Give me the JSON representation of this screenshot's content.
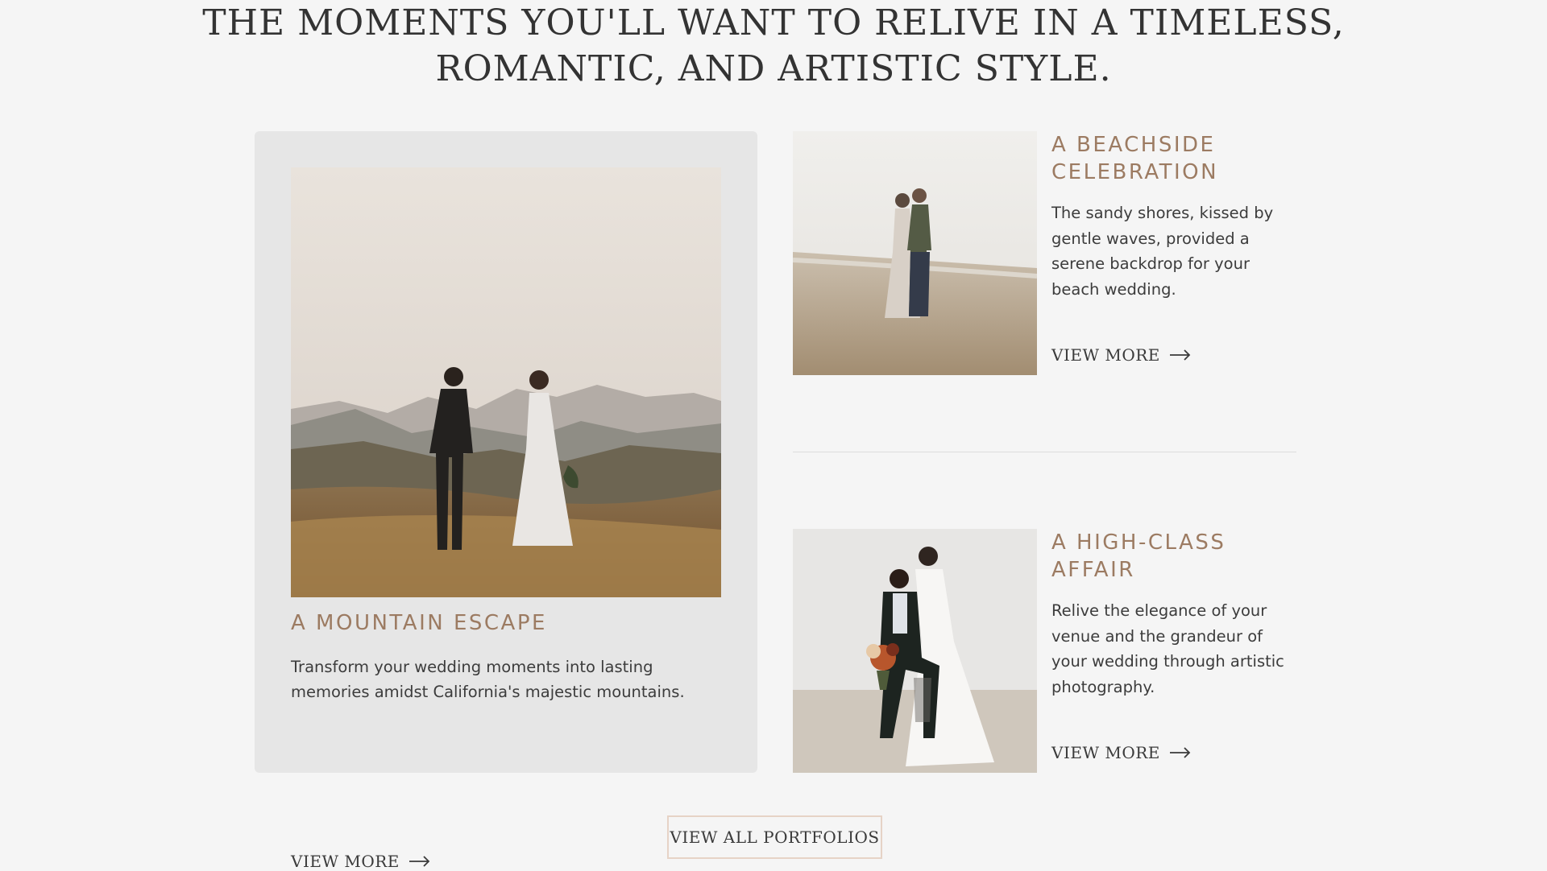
{
  "headline": {
    "line1": "THE MOMENTS YOU'LL WANT TO RELIVE IN A TIMELESS,",
    "line2": "ROMANTIC, AND ARTISTIC STYLE."
  },
  "featured": {
    "title": "A MOUNTAIN ESCAPE",
    "description": "Transform your wedding moments into lasting memories amidst California's majestic mountains.",
    "link_label": "VIEW MORE",
    "link_icon": "arrow-right-icon"
  },
  "items": [
    {
      "title": "A BEACHSIDE CELEBRATION",
      "description": "The sandy shores, kissed by gentle waves, provided a serene backdrop for your beach wedding.",
      "link_label": "VIEW MORE",
      "link_icon": "arrow-right-icon"
    },
    {
      "title": "A HIGH-CLASS AFFAIR",
      "description": "Relive the elegance of your venue and the grandeur of your wedding through artistic photography.",
      "link_label": "VIEW MORE",
      "link_icon": "arrow-right-icon"
    }
  ],
  "cta": {
    "label": "VIEW ALL PORTFOLIOS"
  },
  "colors": {
    "background": "#f5f5f5",
    "card": "#e6e6e6",
    "accent": "#9c7b62",
    "text": "#3a3a3a",
    "button_border": "#e6d3c6"
  }
}
